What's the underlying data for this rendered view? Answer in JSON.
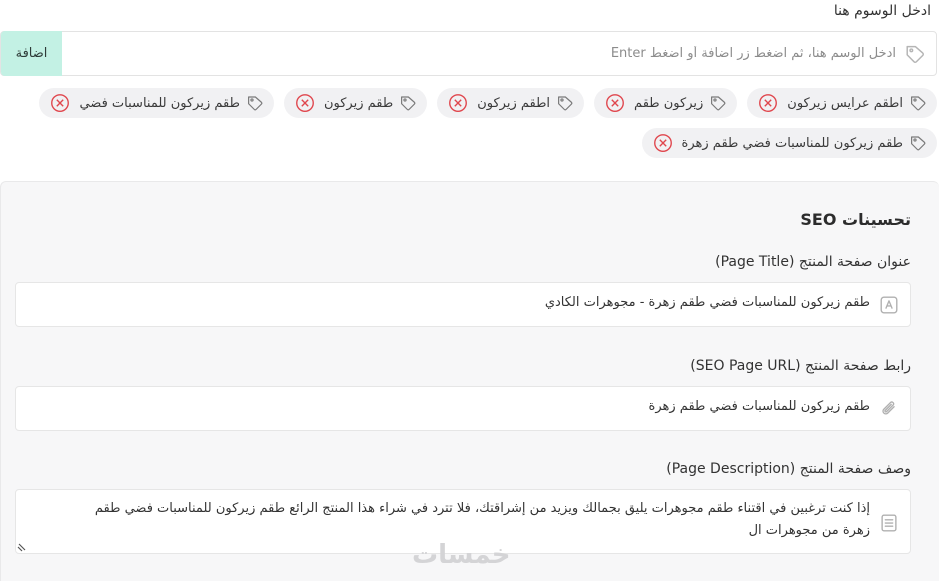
{
  "tags_section": {
    "label": "ادخل الوسوم هنا",
    "input_placeholder": "ادخل الوسم هنا، ثم اضغط زر اضافة أو اضغط Enter",
    "add_button": "اضافة",
    "tags": [
      "اطقم عرايس زيركون",
      "زيركون طقم",
      "اطقم زيركون",
      "طقم زيركون",
      "طقم زيركون للمناسبات فضي",
      "طقم زيركون للمناسبات فضي طقم زهرة"
    ]
  },
  "seo": {
    "title": "تحسينات SEO",
    "page_title": {
      "label": "عنوان صفحة المنتج (Page Title)",
      "value": "طقم زيركون للمناسبات فضي طقم زهرة - مجوهرات الكادي"
    },
    "page_url": {
      "label": "رابط صفحة المنتج (SEO Page URL)",
      "value": "طقم زيركون للمناسبات فضي طقم زهرة"
    },
    "page_description": {
      "label": "وصف صفحة المنتج (Page Description)",
      "value": "إذا كنت ترغبين في اقتناء طقم مجوهرات يليق بجمالك ويزيد من إشراقتك، فلا تترد في شراء هذا المنتج الرائع طقم زيركون للمناسبات فضي طقم زهرة من مجوهرات ال"
    }
  },
  "watermark": "خمسات",
  "colors": {
    "add_button_bg": "#c3f1e4",
    "tag_bg": "#f1f1f3",
    "remove_icon": "#e0464d",
    "panel_bg": "#f7f7f8"
  },
  "icons": {
    "tag": "tag-icon",
    "remove": "remove-circle-x-icon",
    "title": "text-box-icon",
    "url": "paperclip-icon",
    "description": "document-lines-icon"
  }
}
